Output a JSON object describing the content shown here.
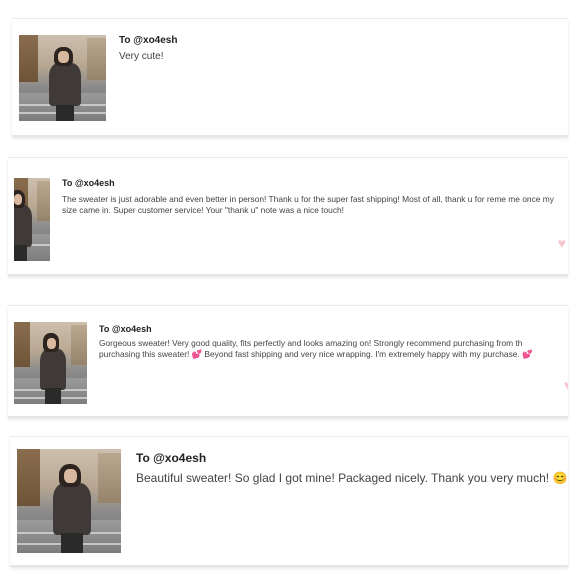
{
  "reviews": [
    {
      "to": "To @xo4esh",
      "message": "Very cute!"
    },
    {
      "to": "To @xo4esh",
      "message": "The sweater is just adorable and even better in person! Thank u for the super fast shipping! Most of all, thank u for reme me once my size came in. Super customer service! Your \"thank u\" note was a nice touch!",
      "heart": "♥"
    },
    {
      "to": "To @xo4esh",
      "message": "Gorgeous sweater! Very good quality, fits perfectly and looks amazing on! Strongly recommend purchasing from th purchasing this sweater! 💕 Beyond fast shipping and very nice wrapping. I'm extremely happy with my purchase. 💕",
      "heart": "♥"
    },
    {
      "to": "To @xo4esh",
      "message": "Beautiful sweater! So glad I got mine! Packaged nicely. Thank you very much! 😊"
    }
  ],
  "icons": {
    "avatar": "photo-of-woman-in-sweater",
    "like": "heart-icon"
  },
  "colors": {
    "heart": "#f6c7d0",
    "text": "#444444",
    "title": "#222222"
  }
}
